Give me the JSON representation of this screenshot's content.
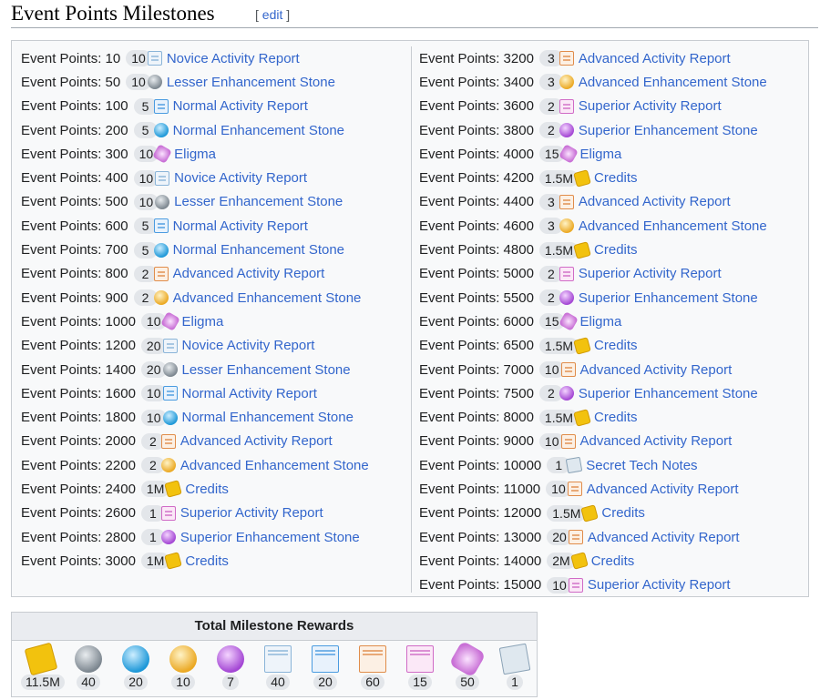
{
  "heading": {
    "title": "Event Points Milestones",
    "edit_open": "[ ",
    "edit_label": "edit",
    "edit_close": " ]"
  },
  "points_prefix": "Event Points: ",
  "left_column": [
    {
      "points": "10",
      "qty": "10",
      "icon": "novice-report",
      "item": "Novice Activity Report"
    },
    {
      "points": "50",
      "qty": "10",
      "icon": "lesser-stone",
      "item": "Lesser Enhancement Stone"
    },
    {
      "points": "100",
      "qty": "5",
      "icon": "normal-report",
      "item": "Normal Activity Report"
    },
    {
      "points": "200",
      "qty": "5",
      "icon": "normal-stone",
      "item": "Normal Enhancement Stone"
    },
    {
      "points": "300",
      "qty": "10",
      "icon": "eligma",
      "item": "Eligma"
    },
    {
      "points": "400",
      "qty": "10",
      "icon": "novice-report",
      "item": "Novice Activity Report"
    },
    {
      "points": "500",
      "qty": "10",
      "icon": "lesser-stone",
      "item": "Lesser Enhancement Stone"
    },
    {
      "points": "600",
      "qty": "5",
      "icon": "normal-report",
      "item": "Normal Activity Report"
    },
    {
      "points": "700",
      "qty": "5",
      "icon": "normal-stone",
      "item": "Normal Enhancement Stone"
    },
    {
      "points": "800",
      "qty": "2",
      "icon": "advanced-report",
      "item": "Advanced Activity Report"
    },
    {
      "points": "900",
      "qty": "2",
      "icon": "advanced-stone",
      "item": "Advanced Enhancement Stone"
    },
    {
      "points": "1000",
      "qty": "10",
      "icon": "eligma",
      "item": "Eligma"
    },
    {
      "points": "1200",
      "qty": "20",
      "icon": "novice-report",
      "item": "Novice Activity Report"
    },
    {
      "points": "1400",
      "qty": "20",
      "icon": "lesser-stone",
      "item": "Lesser Enhancement Stone"
    },
    {
      "points": "1600",
      "qty": "10",
      "icon": "normal-report",
      "item": "Normal Activity Report"
    },
    {
      "points": "1800",
      "qty": "10",
      "icon": "normal-stone",
      "item": "Normal Enhancement Stone"
    },
    {
      "points": "2000",
      "qty": "2",
      "icon": "advanced-report",
      "item": "Advanced Activity Report"
    },
    {
      "points": "2200",
      "qty": "2",
      "icon": "advanced-stone",
      "item": "Advanced Enhancement Stone"
    },
    {
      "points": "2400",
      "qty": "1M",
      "icon": "credits",
      "item": "Credits"
    },
    {
      "points": "2600",
      "qty": "1",
      "icon": "superior-report",
      "item": "Superior Activity Report"
    },
    {
      "points": "2800",
      "qty": "1",
      "icon": "superior-stone",
      "item": "Superior Enhancement Stone"
    },
    {
      "points": "3000",
      "qty": "1M",
      "icon": "credits",
      "item": "Credits"
    }
  ],
  "right_column": [
    {
      "points": "3200",
      "qty": "3",
      "icon": "advanced-report",
      "item": "Advanced Activity Report"
    },
    {
      "points": "3400",
      "qty": "3",
      "icon": "advanced-stone",
      "item": "Advanced Enhancement Stone"
    },
    {
      "points": "3600",
      "qty": "2",
      "icon": "superior-report",
      "item": "Superior Activity Report"
    },
    {
      "points": "3800",
      "qty": "2",
      "icon": "superior-stone",
      "item": "Superior Enhancement Stone"
    },
    {
      "points": "4000",
      "qty": "15",
      "icon": "eligma",
      "item": "Eligma"
    },
    {
      "points": "4200",
      "qty": "1.5M",
      "icon": "credits",
      "item": "Credits"
    },
    {
      "points": "4400",
      "qty": "3",
      "icon": "advanced-report",
      "item": "Advanced Activity Report"
    },
    {
      "points": "4600",
      "qty": "3",
      "icon": "advanced-stone",
      "item": "Advanced Enhancement Stone"
    },
    {
      "points": "4800",
      "qty": "1.5M",
      "icon": "credits",
      "item": "Credits"
    },
    {
      "points": "5000",
      "qty": "2",
      "icon": "superior-report",
      "item": "Superior Activity Report"
    },
    {
      "points": "5500",
      "qty": "2",
      "icon": "superior-stone",
      "item": "Superior Enhancement Stone"
    },
    {
      "points": "6000",
      "qty": "15",
      "icon": "eligma",
      "item": "Eligma"
    },
    {
      "points": "6500",
      "qty": "1.5M",
      "icon": "credits",
      "item": "Credits"
    },
    {
      "points": "7000",
      "qty": "10",
      "icon": "advanced-report",
      "item": "Advanced Activity Report"
    },
    {
      "points": "7500",
      "qty": "2",
      "icon": "superior-stone",
      "item": "Superior Enhancement Stone"
    },
    {
      "points": "8000",
      "qty": "1.5M",
      "icon": "credits",
      "item": "Credits"
    },
    {
      "points": "9000",
      "qty": "10",
      "icon": "advanced-report",
      "item": "Advanced Activity Report"
    },
    {
      "points": "10000",
      "qty": "1",
      "icon": "secret-notes",
      "item": "Secret Tech Notes"
    },
    {
      "points": "11000",
      "qty": "10",
      "icon": "advanced-report",
      "item": "Advanced Activity Report"
    },
    {
      "points": "12000",
      "qty": "1.5M",
      "icon": "credits",
      "item": "Credits"
    },
    {
      "points": "13000",
      "qty": "20",
      "icon": "advanced-report",
      "item": "Advanced Activity Report"
    },
    {
      "points": "14000",
      "qty": "2M",
      "icon": "credits",
      "item": "Credits"
    },
    {
      "points": "15000",
      "qty": "10",
      "icon": "superior-report",
      "item": "Superior Activity Report"
    }
  ],
  "totals": {
    "title": "Total Milestone Rewards",
    "items": [
      {
        "icon": "credits",
        "count": "11.5M"
      },
      {
        "icon": "lesser-stone",
        "count": "40"
      },
      {
        "icon": "normal-stone",
        "count": "20"
      },
      {
        "icon": "advanced-stone",
        "count": "10"
      },
      {
        "icon": "superior-stone",
        "count": "7"
      },
      {
        "icon": "novice-report",
        "count": "40"
      },
      {
        "icon": "normal-report",
        "count": "20"
      },
      {
        "icon": "advanced-report",
        "count": "60"
      },
      {
        "icon": "superior-report",
        "count": "15"
      },
      {
        "icon": "eligma",
        "count": "50"
      },
      {
        "icon": "secret-notes",
        "count": "1"
      }
    ]
  }
}
